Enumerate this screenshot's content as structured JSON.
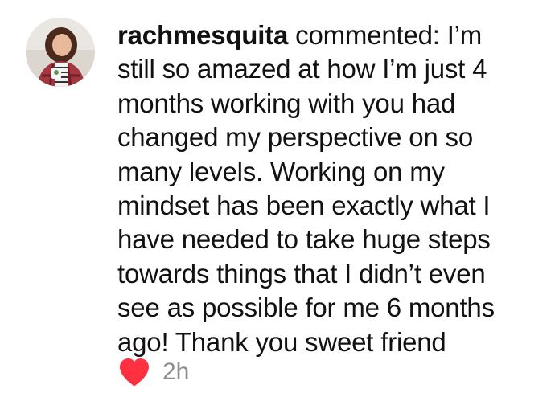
{
  "comment": {
    "username": "rachmesquita",
    "lines": [
      " commented: I’m",
      "still so amazed at how I’m just 4",
      "months working with you had",
      "changed my perspective on so",
      "many levels.  Working on my",
      "mindset has been exactly what I",
      "have needed to take huge steps",
      "towards things that I didn’t even",
      "see as possible for me 6 months",
      "ago!  Thank you sweet friend"
    ],
    "timestamp": "2h",
    "like_icon": "heart-icon",
    "like_color": "#ff3040"
  }
}
